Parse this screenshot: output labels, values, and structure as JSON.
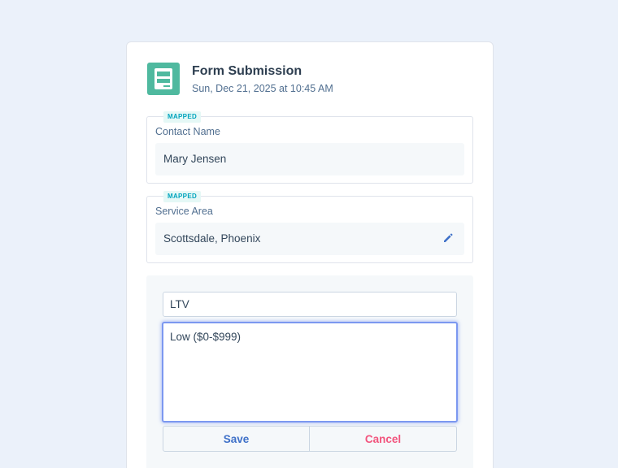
{
  "header": {
    "title": "Form Submission",
    "timestamp": "Sun, Dec 21, 2025 at 10:45 AM",
    "icon": "form-icon"
  },
  "fields": [
    {
      "badge": "MAPPED",
      "label": "Contact Name",
      "value": "Mary Jensen"
    },
    {
      "badge": "MAPPED",
      "label": "Service Area",
      "value": "Scottsdale, Phoenix",
      "action_icon": "pencil-icon"
    }
  ],
  "editor": {
    "property_value": "LTV",
    "text_value": "Low ($0-$999)",
    "save_label": "Save",
    "cancel_label": "Cancel"
  },
  "colors": {
    "background": "#ebf1fa",
    "icon_bg": "#4fb99f",
    "badge_text": "#00a4bd",
    "save": "#3e70c8",
    "cancel": "#f2547d",
    "focus": "#7c98f0"
  }
}
